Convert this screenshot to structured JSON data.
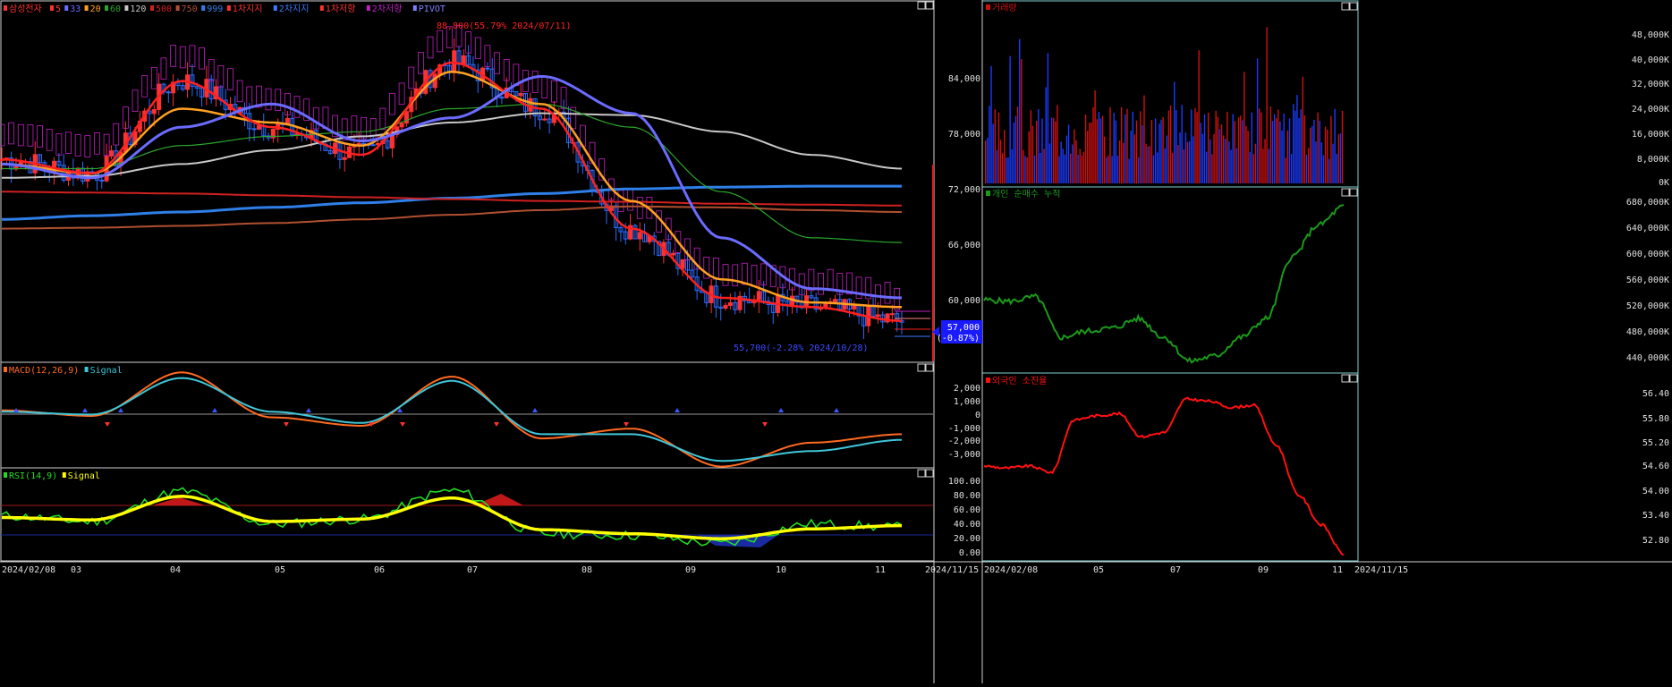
{
  "colors": {
    "bg": "#000000",
    "frame": "#c8c8c8",
    "panel_border": "#7fd1d1",
    "candle_up": "#ff3030",
    "candle_dn": "#2a6cff",
    "ma5": "#ff2020",
    "ma20": "#ffa020",
    "ma60": "#2aa62a",
    "ma120": "#c8c8c8",
    "ma500": "#d02020",
    "ma999": "#2f7fe8",
    "ma750": "#b05030",
    "ma_extra": "#6b6bff",
    "macd": "#ff6a20",
    "macd_signal": "#3fc6d8",
    "rsi": "#22dd22",
    "rsi_signal": "#ffff00",
    "vol_up": "#d01010",
    "vol_dn": "#1a3aff",
    "individual": "#1a9a1a",
    "foreign": "#ff1010",
    "price_box": "#1a1aff"
  },
  "main_panel": {
    "legend": [
      "삼성전자",
      "5",
      "33",
      "20",
      "60",
      "120",
      "500",
      "750",
      "999",
      "1차지지",
      "2차지지",
      "1차저항",
      "2차저항",
      "PIVOT"
    ],
    "high_note": "88,800(55.79% 2024/07/11)",
    "low_note": "55,700(-2.28% 2024/10/28)",
    "price_ticks": [
      "84,000",
      "78,000",
      "72,000",
      "66,000",
      "60,000"
    ],
    "current_price": "57,000",
    "current_change": "(-0.87%)"
  },
  "macd_panel": {
    "legend": [
      "MACD(12,26,9)",
      "Signal"
    ],
    "ticks": [
      "2,000",
      "1,000",
      "0",
      "-1,000",
      "-2,000",
      "-3,000"
    ]
  },
  "rsi_panel": {
    "legend": [
      "RSI(14,9)",
      "Signal"
    ],
    "ticks": [
      "100.00",
      "80.00",
      "60.00",
      "40.00",
      "20.00",
      "0.00"
    ]
  },
  "volume_panel": {
    "title": "거래량",
    "ticks": [
      "48,000K",
      "40,000K",
      "32,000K",
      "24,000K",
      "16,000K",
      "8,000K",
      "0K"
    ]
  },
  "individual_panel": {
    "title": "개인 순매수 누적",
    "ticks": [
      "680,000K",
      "640,000K",
      "600,000K",
      "560,000K",
      "520,000K",
      "480,000K",
      "440,000K"
    ]
  },
  "foreign_panel": {
    "title": "외국인 소진율",
    "ticks": [
      "56.40",
      "55.80",
      "55.20",
      "54.60",
      "54.00",
      "53.40",
      "52.80"
    ]
  },
  "x_axis_left": [
    "2024/02/08",
    "03",
    "04",
    "05",
    "06",
    "07",
    "08",
    "09",
    "10",
    "11",
    "2024/11/15"
  ],
  "x_axis_right": [
    "2024/02/08",
    "05",
    "07",
    "09",
    "11",
    "2024/11/15"
  ],
  "chart_data": [
    {
      "type": "line",
      "title": "삼성전자",
      "x": [
        "2024/02/08",
        "2024/03",
        "2024/04",
        "2024/05",
        "2024/06",
        "2024/07",
        "2024/08",
        "2024/09",
        "2024/10",
        "2024/11",
        "2024/11/15"
      ],
      "ylim": [
        53000,
        91000
      ],
      "series": [
        {
          "name": "5",
          "values": [
            74500,
            73000,
            83000,
            78000,
            75000,
            85000,
            80000,
            67000,
            59500,
            58500,
            57000
          ]
        },
        {
          "name": "20",
          "values": [
            74000,
            73000,
            80000,
            78500,
            76000,
            84000,
            80500,
            70000,
            61500,
            59000,
            58500
          ]
        },
        {
          "name": "60",
          "values": [
            73500,
            73500,
            76000,
            77000,
            77500,
            80000,
            80500,
            78000,
            71000,
            66000,
            65500
          ]
        },
        {
          "name": "120",
          "values": [
            72500,
            72700,
            74000,
            75500,
            77000,
            78500,
            79500,
            79300,
            77500,
            75000,
            73500
          ]
        },
        {
          "name": "500",
          "values": [
            71000,
            70900,
            70800,
            70600,
            70400,
            70200,
            70000,
            69900,
            69700,
            69600,
            69500
          ]
        },
        {
          "name": "750",
          "values": [
            67000,
            67100,
            67300,
            67600,
            68000,
            68500,
            69000,
            69400,
            69300,
            69000,
            68800
          ]
        },
        {
          "name": "999",
          "values": [
            68000,
            68400,
            68800,
            69300,
            69800,
            70300,
            70800,
            71300,
            71500,
            71600,
            71600
          ]
        }
      ],
      "annotations": [
        "88,800(55.79% 2024/07/11)",
        "55,700(-2.28% 2024/10/28)"
      ],
      "current_price": 57000,
      "change_pct": -0.87
    },
    {
      "type": "line",
      "title": "MACD(12,26,9)",
      "ylim": [
        -3800,
        3200
      ],
      "x": [
        "2024/02/08",
        "2024/03",
        "2024/04",
        "2024/05",
        "2024/06",
        "2024/07",
        "2024/08",
        "2024/09",
        "2024/10",
        "2024/11",
        "2024/11/15"
      ],
      "series": [
        {
          "name": "MACD(12,26,9)",
          "values": [
            100,
            -300,
            2800,
            -400,
            -1000,
            2500,
            -1900,
            -1200,
            -3900,
            -2200,
            -1600
          ]
        },
        {
          "name": "Signal",
          "values": [
            0,
            -200,
            2400,
            0,
            -800,
            2200,
            -1600,
            -1600,
            -3500,
            -2800,
            -2000
          ]
        }
      ]
    },
    {
      "type": "line",
      "title": "RSI(14,9)",
      "ylim": [
        0,
        100
      ],
      "x": [
        "2024/02/08",
        "2024/03",
        "2024/04",
        "2024/05",
        "2024/06",
        "2024/07",
        "2024/08",
        "2024/09",
        "2024/10",
        "2024/11",
        "2024/11/15"
      ],
      "series": [
        {
          "name": "RSI(14,9)",
          "values": [
            52,
            45,
            82,
            42,
            48,
            83,
            30,
            28,
            18,
            42,
            38
          ]
        },
        {
          "name": "Signal",
          "values": [
            50,
            47,
            76,
            45,
            48,
            74,
            35,
            30,
            24,
            36,
            40
          ]
        }
      ]
    },
    {
      "type": "bar",
      "title": "거래량",
      "ylim": [
        0,
        54000
      ],
      "x": [
        "2024/02/08",
        "2024/05",
        "2024/07",
        "2024/09",
        "2024/11",
        "2024/11/15"
      ],
      "values": [
        18000,
        22000,
        26000,
        20000,
        30000,
        15000
      ]
    },
    {
      "type": "line",
      "title": "개인 순매수 누적",
      "ylim": [
        420000,
        690000
      ],
      "x": [
        "2024/02/08",
        "2024/05",
        "2024/07",
        "2024/09",
        "2024/11",
        "2024/11/15"
      ],
      "values": [
        530000,
        470000,
        495000,
        430000,
        520000,
        680000
      ]
    },
    {
      "type": "line",
      "title": "외국인 소진율",
      "ylim": [
        52.5,
        56.6
      ],
      "x": [
        "2024/02/08",
        "2024/05",
        "2024/07",
        "2024/09",
        "2024/11",
        "2024/11/15"
      ],
      "values": [
        54.7,
        55.9,
        55.3,
        56.2,
        53.7,
        52.6
      ]
    }
  ]
}
